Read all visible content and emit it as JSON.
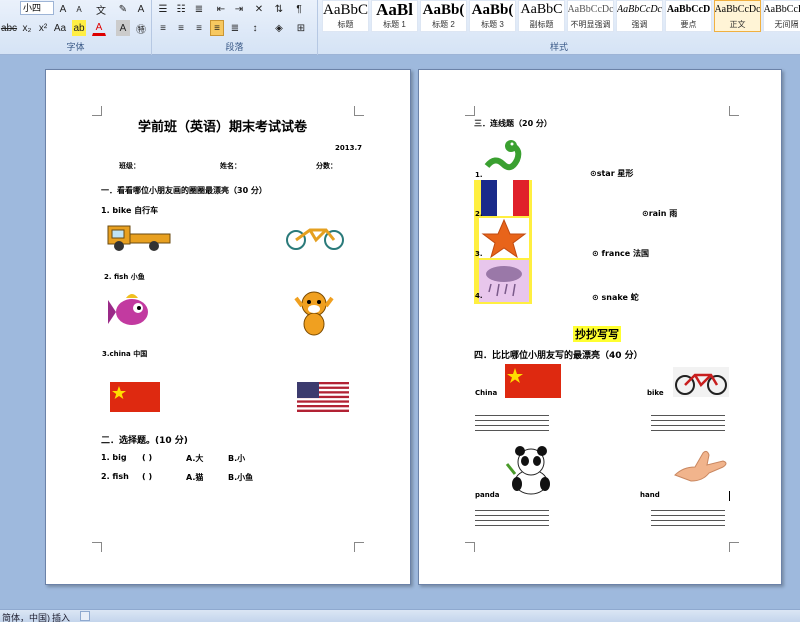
{
  "ribbon": {
    "font_size": "小四",
    "font_group_label": "字体",
    "paragraph_group_label": "段落",
    "styles_group_label": "样式",
    "styles": [
      {
        "sample": "AaBbC",
        "name": "标题"
      },
      {
        "sample": "AaBl",
        "name": "标题 1"
      },
      {
        "sample": "AaBb(",
        "name": "标题 2"
      },
      {
        "sample": "AaBb(",
        "name": "标题 3"
      },
      {
        "sample": "AaBbC",
        "name": "副标题"
      },
      {
        "sample": "AaBbCcDc",
        "name": "不明显强调"
      },
      {
        "sample": "AaBbCcDc",
        "name": "强调"
      },
      {
        "sample": "AaBbCcD",
        "name": "要点"
      },
      {
        "sample": "AaBbCcDc",
        "name": "正文"
      },
      {
        "sample": "AaBbCcDc",
        "name": "无间隔"
      }
    ]
  },
  "page1": {
    "title": "学前班（英语）期末考试试卷",
    "date": "2013.7",
    "class_label": "班级：",
    "name_label": "姓名：",
    "score_label": "分数：",
    "section1": "一．看看哪位小朋友画的圈圈最漂亮（30 分）",
    "q1": "1. bike  自行车",
    "q2": "2. fish  小鱼",
    "q3": "3.china  中国",
    "section2": "二．选择题。(10 分)",
    "choice1": {
      "num": "1. big",
      "paren": "(         )",
      "a": "A.大",
      "b": "B.小"
    },
    "choice2": {
      "num": "2. fish",
      "paren": "(         )",
      "a": "A.猫",
      "b": "B.小鱼"
    }
  },
  "page2": {
    "section3": "三．连线题（20 分）",
    "nums": [
      "1.",
      "2.",
      "3.",
      "4."
    ],
    "words": [
      "⊙star 星形",
      "⊙rain 雨",
      "⊙  france 法国",
      "⊙  snake 蛇"
    ],
    "banner": "抄抄写写",
    "section4": "四．比比哪位小朋友写的最漂亮（40 分）",
    "labels": {
      "china": "China",
      "bike": "bike",
      "panda": "panda",
      "hand": "hand"
    }
  },
  "status": {
    "lang": "简体，中国)",
    "mode": "插入"
  }
}
